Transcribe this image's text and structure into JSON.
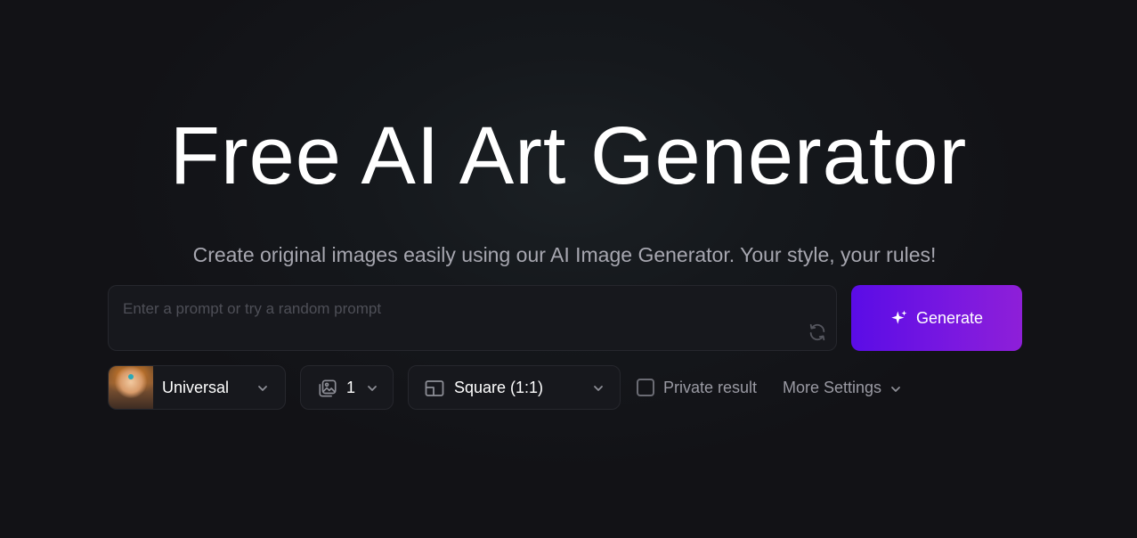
{
  "hero": {
    "title": "Free AI Art Generator",
    "subtitle": "Create original images easily using our AI Image Generator. Your style, your rules!"
  },
  "prompt": {
    "placeholder": "Enter a prompt or try a random prompt",
    "value": ""
  },
  "generate": {
    "label": "Generate",
    "colors": [
      "#5a0ce6",
      "#8e1fd8"
    ]
  },
  "controls": {
    "model": {
      "label": "Universal"
    },
    "image_count": {
      "value": "1"
    },
    "aspect_ratio": {
      "label": "Square (1:1)"
    },
    "private_result": {
      "label": "Private result",
      "checked": false
    },
    "more_settings": {
      "label": "More Settings"
    }
  },
  "icons": [
    "refresh-icon",
    "sparkle-icon",
    "chevron-down-icon",
    "images-icon",
    "aspect-ratio-icon",
    "checkbox-icon"
  ]
}
